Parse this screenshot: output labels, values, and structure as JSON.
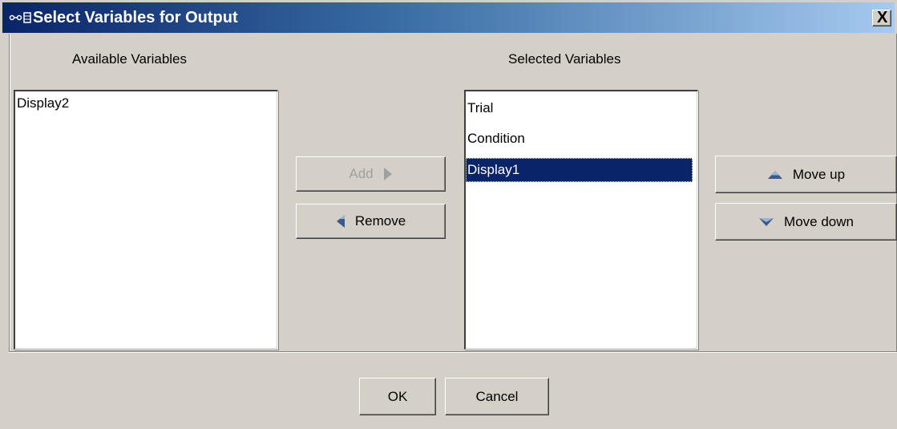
{
  "window": {
    "title": "Select Variables for Output",
    "close_label": "X"
  },
  "available": {
    "heading": "Available Variables",
    "items": [
      "Display2"
    ]
  },
  "selected": {
    "heading": "Selected Variables",
    "items": [
      "Trial",
      "Condition",
      "Display1"
    ],
    "selected_item": "Display1"
  },
  "buttons": {
    "add": "Add",
    "remove": "Remove",
    "move_up": "Move up",
    "move_down": "Move down",
    "ok": "OK",
    "cancel": "Cancel"
  },
  "colors": {
    "titlebar_start": "#0a246a",
    "titlebar_end": "#a6caf0",
    "selection": "#0a246a",
    "face": "#d4d0c8"
  }
}
